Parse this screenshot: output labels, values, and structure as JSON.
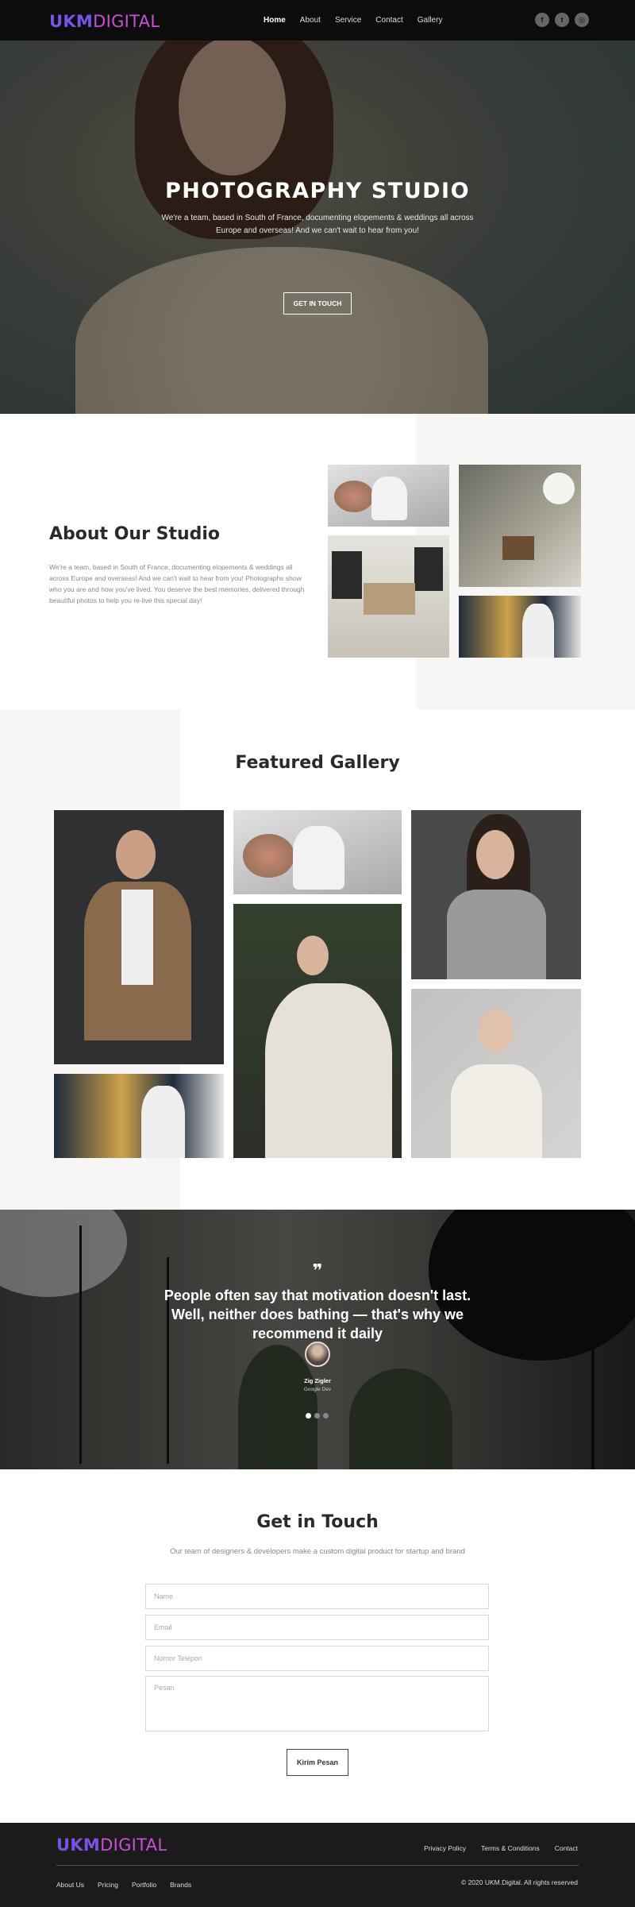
{
  "header": {
    "logo_part1": "UKM",
    "logo_part2": "DIGITAL",
    "nav": [
      "Home",
      "About",
      "Service",
      "Contact",
      "Gallery"
    ],
    "social_icons": [
      "facebook-icon",
      "twitter-icon",
      "instagram-icon"
    ]
  },
  "hero": {
    "title": "PHOTOGRAPHY STUDIO",
    "subtitle": "We're a team, based in South of France, documenting elopements & weddings all across Europe and overseas! And we can't wait to hear from you!",
    "button": "GET IN TOUCH"
  },
  "about": {
    "title": "About Our Studio",
    "text": "We're a team, based in South of France, documenting elopements & weddings all across Europe and overseas! And we can't wait to hear from you! Photographs show who you are and how you've lived. You deserve the best memories, delivered through beautiful photos to help you re-live this special day!"
  },
  "gallery": {
    "title": "Featured Gallery"
  },
  "testimonial": {
    "quote_mark": "❞",
    "quote": "People often say that motivation doesn't last. Well, neither does bathing — that's why we recommend it daily",
    "name": "Zig Zigler",
    "role": "Google Dev",
    "slides": 3,
    "active_slide": 1
  },
  "contact": {
    "title": "Get in Touch",
    "description": "Our team of designers & developers make a custom digital product for startup and brand",
    "fields": {
      "name": "Name",
      "email": "Email",
      "phone": "Nomor Telepon",
      "message": "Pesan"
    },
    "submit": "Kirim Pesan"
  },
  "footer": {
    "logo_part1": "UKM",
    "logo_part2": "DIGITAL",
    "top_links": [
      "Privacy Policy",
      "Terms & Conditions",
      "Contact"
    ],
    "bottom_links": [
      "About Us",
      "Pricing",
      "Portfolio",
      "Brands"
    ],
    "copyright": "© 2020 UKM.Digital. All rights reserved"
  }
}
